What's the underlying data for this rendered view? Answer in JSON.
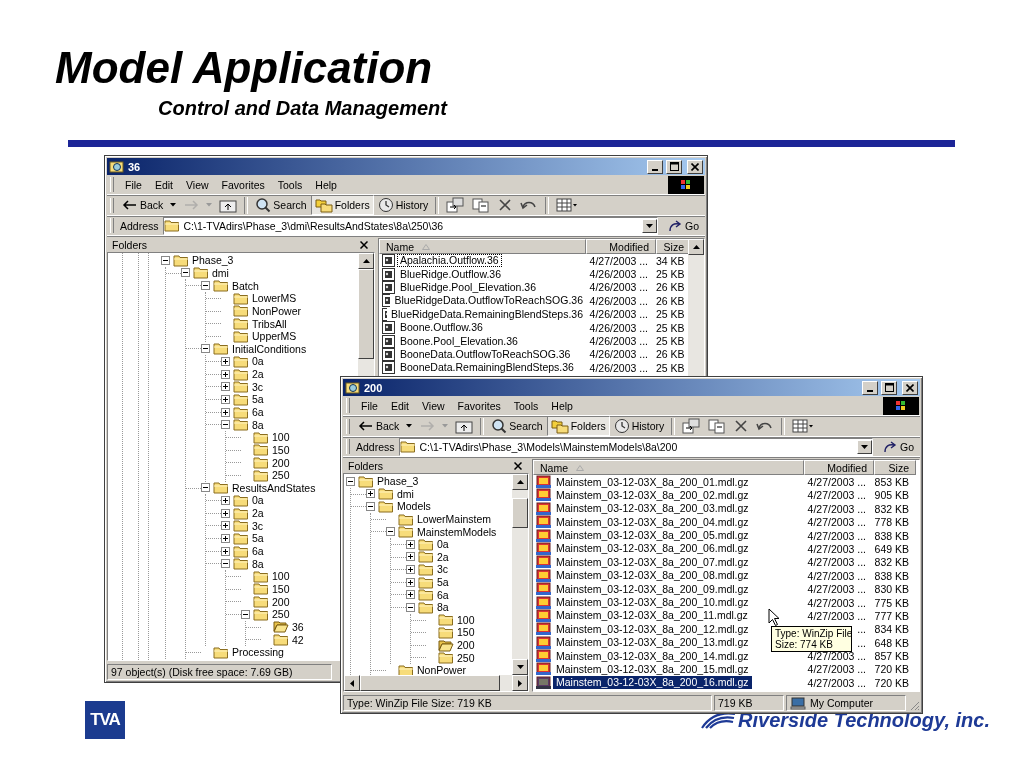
{
  "slide": {
    "title": "Model Application",
    "subtitle": "Control and Data Management"
  },
  "windows": [
    {
      "title": "36",
      "menu": [
        "File",
        "Edit",
        "View",
        "Favorites",
        "Tools",
        "Help"
      ],
      "toolbar": [
        [
          {
            "kind": "back",
            "label": "Back",
            "pressed": false,
            "disabled": false
          },
          {
            "kind": "forward",
            "pressed": false,
            "disabled": true
          },
          {
            "kind": "up",
            "pressed": false,
            "disabled": false
          }
        ],
        [
          {
            "kind": "search",
            "label": "Search",
            "pressed": false,
            "disabled": false
          },
          {
            "kind": "folders",
            "label": "Folders",
            "pressed": true,
            "disabled": false
          },
          {
            "kind": "history",
            "label": "History",
            "pressed": false,
            "disabled": false
          }
        ],
        [
          {
            "kind": "move",
            "pressed": false,
            "disabled": false
          },
          {
            "kind": "copy",
            "pressed": false,
            "disabled": false
          },
          {
            "kind": "delete",
            "pressed": false,
            "disabled": false
          },
          {
            "kind": "undo",
            "pressed": false,
            "disabled": false
          }
        ],
        [
          {
            "kind": "views",
            "pressed": false,
            "disabled": false
          }
        ]
      ],
      "address": {
        "label": "Address",
        "path": "C:\\1-TVAdirs\\Phase_3\\dmi\\ResultsAndStates\\8a\\250\\36",
        "go": "Go"
      },
      "folders_pane": {
        "title": "Folders",
        "tree": [
          {
            "label": "Phase_3",
            "expanded": true,
            "current": false,
            "children": [
              {
                "label": "dmi",
                "expanded": true,
                "current": false,
                "children": [
                  {
                    "label": "Batch",
                    "expanded": true,
                    "current": false,
                    "children": [
                      {
                        "label": "LowerMS",
                        "current": false
                      },
                      {
                        "label": "NonPower",
                        "current": false
                      },
                      {
                        "label": "TribsAll",
                        "current": false
                      },
                      {
                        "label": "UpperMS",
                        "current": false
                      }
                    ]
                  },
                  {
                    "label": "InitialConditions",
                    "expanded": true,
                    "current": false,
                    "children": [
                      {
                        "label": "0a",
                        "expanded": false,
                        "current": false
                      },
                      {
                        "label": "2a",
                        "expanded": false,
                        "current": false
                      },
                      {
                        "label": "3c",
                        "expanded": false,
                        "current": false
                      },
                      {
                        "label": "5a",
                        "expanded": false,
                        "current": false
                      },
                      {
                        "label": "6a",
                        "expanded": false,
                        "current": false
                      },
                      {
                        "label": "8a",
                        "expanded": true,
                        "current": false,
                        "children": [
                          {
                            "label": "100",
                            "current": false
                          },
                          {
                            "label": "150",
                            "current": false
                          },
                          {
                            "label": "200",
                            "current": false
                          },
                          {
                            "label": "250",
                            "current": false
                          }
                        ]
                      }
                    ]
                  },
                  {
                    "label": "ResultsAndStates",
                    "expanded": true,
                    "current": false,
                    "children": [
                      {
                        "label": "0a",
                        "expanded": false,
                        "current": false
                      },
                      {
                        "label": "2a",
                        "expanded": false,
                        "current": false
                      },
                      {
                        "label": "3c",
                        "expanded": false,
                        "current": false
                      },
                      {
                        "label": "5a",
                        "expanded": false,
                        "current": false
                      },
                      {
                        "label": "6a",
                        "expanded": false,
                        "current": false
                      },
                      {
                        "label": "8a",
                        "expanded": true,
                        "current": false,
                        "children": [
                          {
                            "label": "100",
                            "current": false
                          },
                          {
                            "label": "150",
                            "current": false
                          },
                          {
                            "label": "200",
                            "current": false
                          },
                          {
                            "label": "250",
                            "expanded": true,
                            "current": false,
                            "children": [
                              {
                                "label": "36",
                                "current": true
                              },
                              {
                                "label": "42",
                                "current": false
                              }
                            ]
                          }
                        ]
                      }
                    ]
                  },
                  {
                    "label": "Processing",
                    "current": false
                  }
                ]
              }
            ]
          }
        ]
      },
      "columns": [
        {
          "label": "Name",
          "sorted": true
        },
        {
          "label": "Modified",
          "sorted": false
        },
        {
          "label": "Size",
          "sorted": false
        }
      ],
      "files": [
        {
          "kind": "data",
          "name": "Apalachia.Outflow.36",
          "modified": "4/27/2003 ...",
          "size": "34 KB",
          "selected": false,
          "focused": true
        },
        {
          "kind": "data",
          "name": "BlueRidge.Outflow.36",
          "modified": "4/26/2003 ...",
          "size": "25 KB",
          "selected": false,
          "focused": false
        },
        {
          "kind": "data",
          "name": "BlueRidge.Pool_Elevation.36",
          "modified": "4/26/2003 ...",
          "size": "26 KB",
          "selected": false,
          "focused": false
        },
        {
          "kind": "data",
          "name": "BlueRidgeData.OutflowToReachSOG.36",
          "modified": "4/26/2003 ...",
          "size": "26 KB",
          "selected": false,
          "focused": false
        },
        {
          "kind": "data",
          "name": "BlueRidgeData.RemainingBlendSteps.36",
          "modified": "4/26/2003 ...",
          "size": "25 KB",
          "selected": false,
          "focused": false
        },
        {
          "kind": "data",
          "name": "Boone.Outflow.36",
          "modified": "4/26/2003 ...",
          "size": "25 KB",
          "selected": false,
          "focused": false
        },
        {
          "kind": "data",
          "name": "Boone.Pool_Elevation.36",
          "modified": "4/26/2003 ...",
          "size": "25 KB",
          "selected": false,
          "focused": false
        },
        {
          "kind": "data",
          "name": "BooneData.OutflowToReachSOG.36",
          "modified": "4/26/2003 ...",
          "size": "26 KB",
          "selected": false,
          "focused": false
        },
        {
          "kind": "data",
          "name": "BooneData.RemainingBlendSteps.36",
          "modified": "4/26/2003 ...",
          "size": "25 KB",
          "selected": false,
          "focused": false
        }
      ],
      "status_bar": [
        {
          "kind": "text",
          "text": "97 object(s) (Disk free space: 7.69 GB)"
        }
      ]
    },
    {
      "title": "200",
      "menu": [
        "File",
        "Edit",
        "View",
        "Favorites",
        "Tools",
        "Help"
      ],
      "toolbar": [
        [
          {
            "kind": "back",
            "label": "Back",
            "pressed": false,
            "disabled": false
          },
          {
            "kind": "forward",
            "pressed": false,
            "disabled": true
          },
          {
            "kind": "up",
            "pressed": false,
            "disabled": false
          }
        ],
        [
          {
            "kind": "search",
            "label": "Search",
            "pressed": false,
            "disabled": false
          },
          {
            "kind": "folders",
            "label": "Folders",
            "pressed": true,
            "disabled": false
          },
          {
            "kind": "history",
            "label": "History",
            "pressed": false,
            "disabled": false
          }
        ],
        [
          {
            "kind": "move",
            "pressed": false,
            "disabled": false
          },
          {
            "kind": "copy",
            "pressed": false,
            "disabled": false
          },
          {
            "kind": "delete",
            "pressed": false,
            "disabled": false
          },
          {
            "kind": "undo",
            "pressed": false,
            "disabled": false
          }
        ],
        [
          {
            "kind": "views",
            "pressed": false,
            "disabled": false
          }
        ]
      ],
      "address": {
        "label": "Address",
        "path": "C:\\1-TVAdirs\\Phase_3\\Models\\MainstemModels\\8a\\200",
        "go": "Go"
      },
      "folders_pane": {
        "title": "Folders",
        "tree": [
          {
            "label": "Phase_3",
            "expanded": true,
            "current": false,
            "children": [
              {
                "label": "dmi",
                "expanded": false,
                "current": false
              },
              {
                "label": "Models",
                "expanded": true,
                "current": false,
                "children": [
                  {
                    "label": "LowerMainstem",
                    "current": false
                  },
                  {
                    "label": "MainstemModels",
                    "expanded": true,
                    "current": false,
                    "children": [
                      {
                        "label": "0a",
                        "expanded": false,
                        "current": false
                      },
                      {
                        "label": "2a",
                        "expanded": false,
                        "current": false
                      },
                      {
                        "label": "3c",
                        "expanded": false,
                        "current": false
                      },
                      {
                        "label": "5a",
                        "expanded": false,
                        "current": false
                      },
                      {
                        "label": "6a",
                        "expanded": false,
                        "current": false
                      },
                      {
                        "label": "8a",
                        "expanded": true,
                        "current": false,
                        "children": [
                          {
                            "label": "100",
                            "current": false
                          },
                          {
                            "label": "150",
                            "current": false
                          },
                          {
                            "label": "200",
                            "current": true
                          },
                          {
                            "label": "250",
                            "current": false
                          }
                        ]
                      }
                    ]
                  },
                  {
                    "label": "NonPower",
                    "current": false
                  }
                ]
              }
            ]
          }
        ]
      },
      "columns": [
        {
          "label": "Name",
          "sorted": true
        },
        {
          "label": "Modified",
          "sorted": false
        },
        {
          "label": "Size",
          "sorted": false
        }
      ],
      "files": [
        {
          "kind": "zip",
          "name": "Mainstem_03-12-03X_8a_200_01.mdl.gz",
          "modified": "4/27/2003 ...",
          "size": "853 KB",
          "selected": false,
          "focused": false
        },
        {
          "kind": "zip",
          "name": "Mainstem_03-12-03X_8a_200_02.mdl.gz",
          "modified": "4/27/2003 ...",
          "size": "905 KB",
          "selected": false,
          "focused": false
        },
        {
          "kind": "zip",
          "name": "Mainstem_03-12-03X_8a_200_03.mdl.gz",
          "modified": "4/27/2003 ...",
          "size": "832 KB",
          "selected": false,
          "focused": false
        },
        {
          "kind": "zip",
          "name": "Mainstem_03-12-03X_8a_200_04.mdl.gz",
          "modified": "4/27/2003 ...",
          "size": "778 KB",
          "selected": false,
          "focused": false
        },
        {
          "kind": "zip",
          "name": "Mainstem_03-12-03X_8a_200_05.mdl.gz",
          "modified": "4/27/2003 ...",
          "size": "838 KB",
          "selected": false,
          "focused": false
        },
        {
          "kind": "zip",
          "name": "Mainstem_03-12-03X_8a_200_06.mdl.gz",
          "modified": "4/27/2003 ...",
          "size": "649 KB",
          "selected": false,
          "focused": false
        },
        {
          "kind": "zip",
          "name": "Mainstem_03-12-03X_8a_200_07.mdl.gz",
          "modified": "4/27/2003 ...",
          "size": "832 KB",
          "selected": false,
          "focused": false
        },
        {
          "kind": "zip",
          "name": "Mainstem_03-12-03X_8a_200_08.mdl.gz",
          "modified": "4/27/2003 ...",
          "size": "838 KB",
          "selected": false,
          "focused": false
        },
        {
          "kind": "zip",
          "name": "Mainstem_03-12-03X_8a_200_09.mdl.gz",
          "modified": "4/27/2003 ...",
          "size": "830 KB",
          "selected": false,
          "focused": false
        },
        {
          "kind": "zip",
          "name": "Mainstem_03-12-03X_8a_200_10.mdl.gz",
          "modified": "4/27/2003 ...",
          "size": "775 KB",
          "selected": false,
          "focused": false
        },
        {
          "kind": "zip",
          "name": "Mainstem_03-12-03X_8a_200_11.mdl.gz",
          "modified": "4/27/2003 ...",
          "size": "777 KB",
          "selected": false,
          "focused": false
        },
        {
          "kind": "zip",
          "name": "Mainstem_03-12-03X_8a_200_12.mdl.gz",
          "modified": "...",
          "size": "834 KB",
          "selected": false,
          "focused": false
        },
        {
          "kind": "zip",
          "name": "Mainstem_03-12-03X_8a_200_13.mdl.gz",
          "modified": "...",
          "size": "648 KB",
          "selected": false,
          "focused": false
        },
        {
          "kind": "zip",
          "name": "Mainstem_03-12-03X_8a_200_14.mdl.gz",
          "modified": "4/27/2003 ...",
          "size": "857 KB",
          "selected": false,
          "focused": false
        },
        {
          "kind": "zip",
          "name": "Mainstem_03-12-03X_8a_200_15.mdl.gz",
          "modified": "4/27/2003 ...",
          "size": "720 KB",
          "selected": false,
          "focused": false
        },
        {
          "kind": "zip",
          "name": "Mainstem_03-12-03X_8a_200_16.mdl.gz",
          "modified": "4/27/2003 ...",
          "size": "720 KB",
          "selected": true,
          "focused": false
        }
      ],
      "tooltip": {
        "lines": [
          "Type: WinZip File",
          "Size: 774 KB"
        ]
      },
      "status_bar": [
        {
          "kind": "text",
          "text": "Type: WinZip File Size: 719 KB"
        },
        {
          "kind": "text",
          "text": "719 KB"
        },
        {
          "kind": "zone",
          "text": "My Computer"
        }
      ]
    }
  ],
  "footer": {
    "logo": "TVA",
    "company": "Riverside Technology, inc."
  }
}
